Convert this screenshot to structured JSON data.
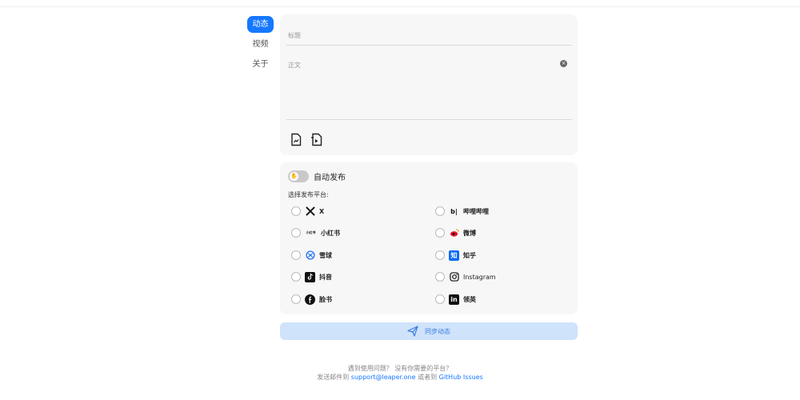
{
  "nav": {
    "items": [
      {
        "label": "动态",
        "active": true
      },
      {
        "label": "视频",
        "active": false
      },
      {
        "label": "关于",
        "active": false
      }
    ]
  },
  "editor": {
    "title_placeholder": "标题",
    "body_placeholder": "正文",
    "clear_glyph": "×"
  },
  "publish": {
    "auto_publish_label": "自动发布",
    "auto_publish_on": false,
    "choose_platforms_label": "选择发布平台:",
    "platforms": [
      {
        "label": "X",
        "icon": "x-logo-icon",
        "checked": false
      },
      {
        "label": "哔哩哔哩",
        "icon": "bilibili-logo-icon",
        "checked": false
      },
      {
        "label": "小红书",
        "icon": "xiaohongshu-logo-icon",
        "icon_text": "小红书",
        "checked": false
      },
      {
        "label": "微博",
        "icon": "weibo-logo-icon",
        "checked": false
      },
      {
        "label": "雪球",
        "icon": "xueqiu-logo-icon",
        "checked": false
      },
      {
        "label": "知乎",
        "icon": "zhihu-logo-icon",
        "icon_text": "知",
        "checked": false
      },
      {
        "label": "抖音",
        "icon": "douyin-logo-icon",
        "checked": false
      },
      {
        "label": "Instagram",
        "icon": "instagram-logo-icon",
        "checked": false
      },
      {
        "label": "脸书",
        "icon": "facebook-logo-icon",
        "checked": false
      },
      {
        "label": "领英",
        "icon": "linkedin-logo-icon",
        "icon_text": "in",
        "checked": false
      }
    ]
  },
  "submit": {
    "label": "同步动态"
  },
  "footer": {
    "line1": "遇到使用问题？ 没有你需要的平台？",
    "prefix": "发送邮件到 ",
    "email": "support@leaper.one",
    "middle": " 或者到 ",
    "github": "GitHub Issues"
  },
  "colors": {
    "accent": "#1677ff",
    "submit_bg": "#cfe3fb",
    "card_bg": "#f7f7f7"
  }
}
